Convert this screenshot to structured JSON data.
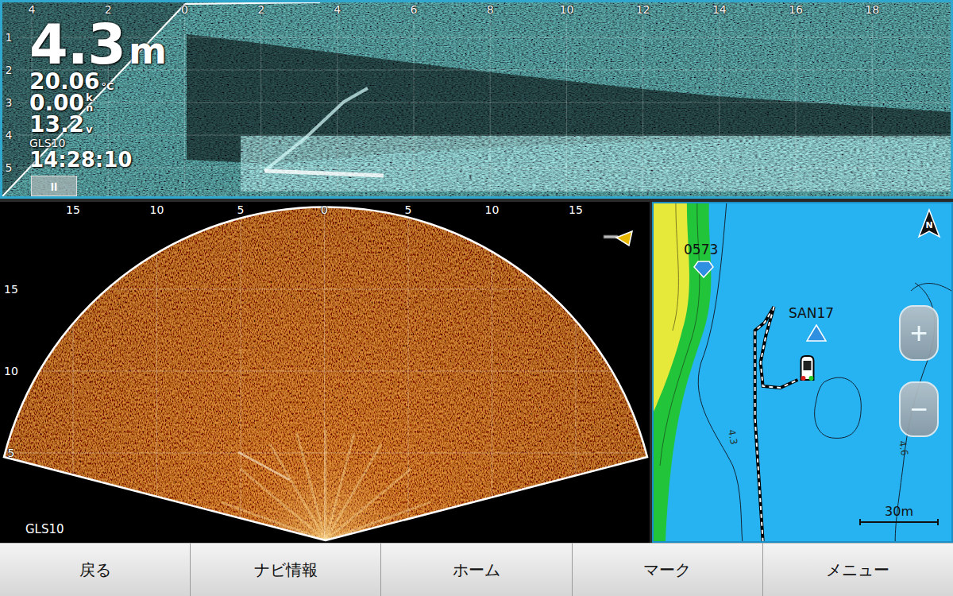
{
  "sidescan": {
    "range_ticks": [
      "4",
      "2",
      "0",
      "2",
      "4",
      "6",
      "8",
      "10",
      "12",
      "14",
      "16",
      "18"
    ],
    "depth_ticks": [
      "1",
      "2",
      "3",
      "4",
      "5"
    ],
    "depth": {
      "value": "4.3",
      "unit": "m"
    },
    "readings": [
      {
        "name": "temperature",
        "value": "20.06",
        "units": [
          "°C"
        ]
      },
      {
        "name": "speed",
        "value": "0.00",
        "units": [
          "k",
          "n"
        ]
      },
      {
        "name": "voltage",
        "value": "13.2",
        "units": [
          "v"
        ]
      }
    ],
    "source": "GLS10",
    "time": "14:28:10",
    "pause": "II"
  },
  "livesight": {
    "range_ticks": [
      "15",
      "10",
      "5",
      "0",
      "5",
      "10",
      "15"
    ],
    "depth_ticks": [
      "15",
      "10",
      "5"
    ],
    "source": "GLS10"
  },
  "chart": {
    "north": "N",
    "marks": [
      {
        "label": "0573",
        "kind": "waypoint"
      },
      {
        "label": "SAN17",
        "kind": "target"
      }
    ],
    "contours": [
      {
        "label": "4.3"
      },
      {
        "label": "4.6"
      }
    ],
    "zoom": [
      "+",
      "−"
    ],
    "scale": "30m"
  },
  "buttons": [
    "戻る",
    "ナビ情報",
    "ホーム",
    "マーク",
    "メニュー"
  ]
}
